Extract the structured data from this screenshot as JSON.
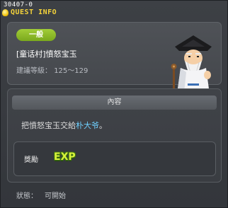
{
  "window": {
    "quest_id": "30407-0",
    "title": "QUEST INFO"
  },
  "summary": {
    "category_badge": "一般",
    "quest_name": "[童话村]憤怒宝玉",
    "level_label": "建議等級：",
    "level_range": "125～129"
  },
  "content": {
    "header": "內容",
    "description_prefix": "把憤怒宝玉交給",
    "npc_name": "朴大爷",
    "description_suffix": "。",
    "reward_label": "獎勵",
    "reward_exp_text": "EXP"
  },
  "status": {
    "label": "狀態：",
    "value": "可開始"
  },
  "colors": {
    "title_gold": "#f3d23a",
    "badge_green": "#8bb92a",
    "npc_link": "#6fd0ff",
    "exp_yellow": "#d8f23b"
  }
}
